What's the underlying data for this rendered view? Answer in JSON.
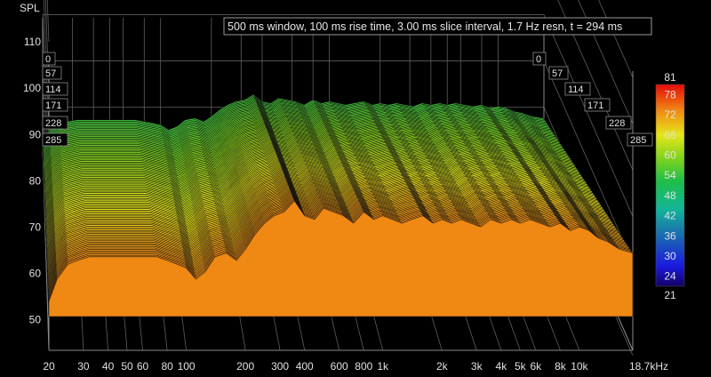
{
  "chart_data": {
    "type": "waterfall",
    "ylabel": "SPL",
    "info_text": "500 ms window, 100 ms rise time, 3.00 ms slice interval, 1.7 Hz resn, t = 294 ms",
    "x_scale": "log",
    "xlim": [
      20,
      18700
    ],
    "x_ticks": [
      {
        "value": 20,
        "label": "20"
      },
      {
        "value": 30,
        "label": "30"
      },
      {
        "value": 40,
        "label": "40"
      },
      {
        "value": 50,
        "label": "50"
      },
      {
        "value": 60,
        "label": "60"
      },
      {
        "value": 80,
        "label": "80"
      },
      {
        "value": 100,
        "label": "100"
      },
      {
        "value": 200,
        "label": "200"
      },
      {
        "value": 300,
        "label": "300"
      },
      {
        "value": 400,
        "label": "400"
      },
      {
        "value": 600,
        "label": "600"
      },
      {
        "value": 800,
        "label": "800"
      },
      {
        "value": 1000,
        "label": "1k"
      },
      {
        "value": 2000,
        "label": "2k"
      },
      {
        "value": 3000,
        "label": "3k"
      },
      {
        "value": 4000,
        "label": "4k"
      },
      {
        "value": 5000,
        "label": "5k"
      },
      {
        "value": 6000,
        "label": "6k"
      },
      {
        "value": 8000,
        "label": "8k"
      },
      {
        "value": 10000,
        "label": "10k"
      },
      {
        "value": 18700,
        "label": "18.7kHz"
      }
    ],
    "ylim": [
      43,
      113
    ],
    "y_ticks": [
      50,
      60,
      70,
      80,
      90,
      100,
      110
    ],
    "time_ticks_ms": [
      0,
      57,
      114,
      171,
      228,
      285
    ],
    "colorbar": {
      "min": 21,
      "max": 81,
      "labels": [
        78,
        72,
        66,
        60,
        54,
        48,
        42,
        36,
        30,
        24
      ],
      "min_label": "21",
      "max_label": "81"
    },
    "front_slice": {
      "freq_hz": [
        20,
        22,
        25,
        28,
        32,
        36,
        40,
        45,
        50,
        56,
        63,
        71,
        80,
        90,
        100,
        112,
        125,
        140,
        160,
        180,
        200,
        224,
        250,
        280,
        315,
        355,
        400,
        450,
        500,
        560,
        630,
        710,
        800,
        900,
        1000,
        1120,
        1250,
        1400,
        1600,
        1800,
        2000,
        2240,
        2500,
        2800,
        3150,
        3550,
        4000,
        4500,
        5000,
        5600,
        6300,
        7100,
        8000,
        9000,
        10000,
        11200,
        12500,
        14000,
        16000,
        18700
      ],
      "spl_db": [
        50,
        56,
        60,
        61,
        62,
        62,
        62,
        62,
        62,
        62,
        62,
        62,
        61,
        60,
        59,
        56,
        58,
        62,
        63,
        61,
        64,
        68,
        71,
        73,
        74,
        77,
        73,
        72,
        75,
        74,
        73,
        71,
        74,
        72,
        73,
        72,
        71,
        72,
        73,
        71,
        72,
        71,
        72,
        71,
        70,
        72,
        71,
        72,
        71,
        72,
        71,
        70,
        71,
        69,
        70,
        69,
        67,
        66,
        64,
        63
      ]
    },
    "slice_count": 95,
    "grid": true
  }
}
